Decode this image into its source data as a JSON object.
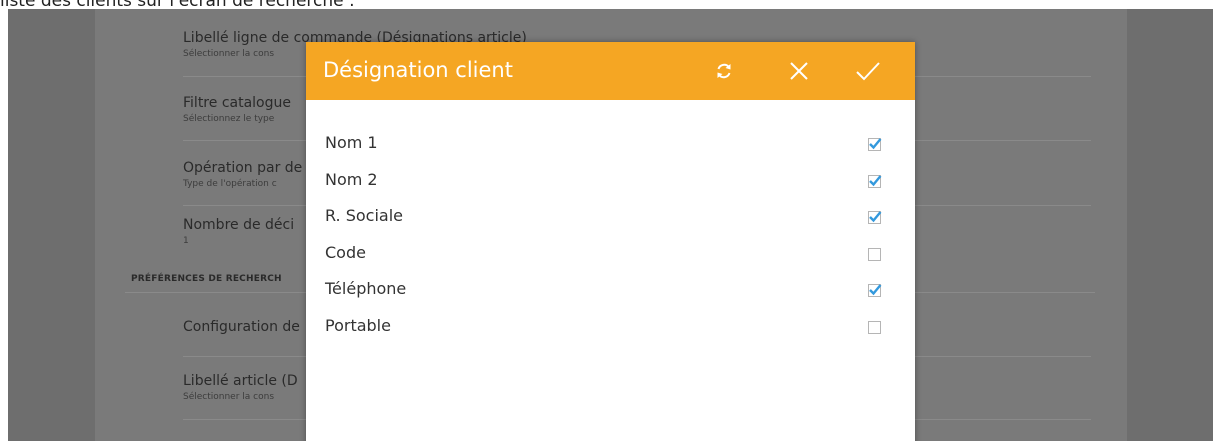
{
  "caption": "liste des clients sur l'écran de recherche :",
  "settings": {
    "items": [
      {
        "title": "Libellé ligne de commande (Désignations article)",
        "subtitle": "Sélectionner la cons"
      },
      {
        "title": "Filtre catalogue",
        "subtitle": "Sélectionnez le type"
      },
      {
        "title": "Opération par de",
        "subtitle": "Type de l'opération c"
      },
      {
        "title": "Nombre de déci",
        "subtitle": "1"
      },
      {
        "title": "Configuration de",
        "subtitle": ""
      },
      {
        "title": "Libellé article (D",
        "subtitle": "Sélectionner la cons"
      }
    ],
    "section_header": "PRÉFÉRENCES DE RECHERCH"
  },
  "dialog": {
    "title": "Désignation client",
    "header_color": "#f5a623",
    "icons": [
      "refresh-icon",
      "close-icon",
      "checkmark-icon"
    ],
    "options": [
      {
        "label": "Nom 1",
        "checked": true
      },
      {
        "label": "Nom 2",
        "checked": true
      },
      {
        "label": "R. Sociale",
        "checked": true
      },
      {
        "label": "Code",
        "checked": false
      },
      {
        "label": "Téléphone",
        "checked": true
      },
      {
        "label": "Portable",
        "checked": false
      }
    ]
  }
}
